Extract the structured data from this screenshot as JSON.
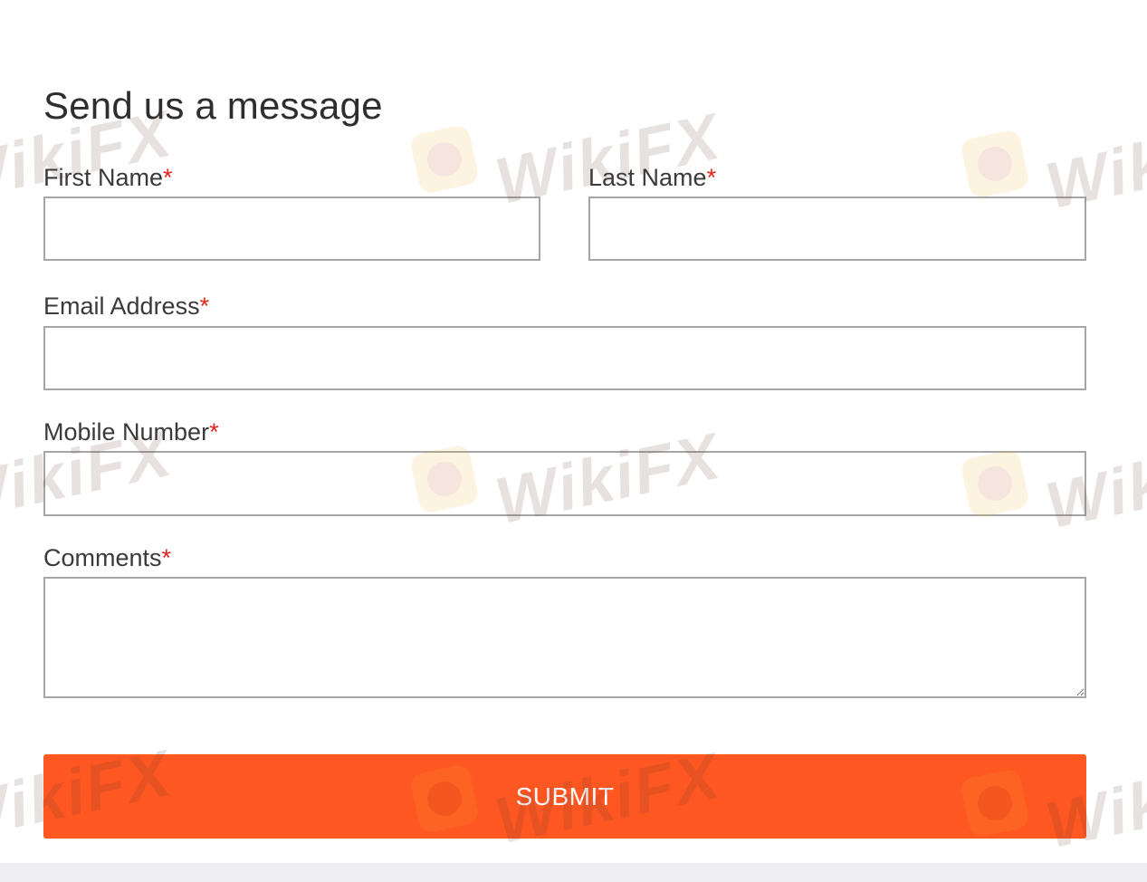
{
  "form": {
    "title": "Send us a message",
    "required_marker": "*",
    "fields": {
      "first_name": {
        "label": "First Name",
        "value": "",
        "placeholder": ""
      },
      "last_name": {
        "label": "Last Name",
        "value": "",
        "placeholder": ""
      },
      "email": {
        "label": "Email Address",
        "value": "",
        "placeholder": ""
      },
      "mobile": {
        "label": "Mobile Number",
        "value": "",
        "placeholder": ""
      },
      "comments": {
        "label": "Comments",
        "value": "",
        "placeholder": ""
      }
    },
    "submit_label": "SUBMIT"
  },
  "watermark": {
    "text": "WikiFX",
    "icon": "wikifx-logo-icon"
  },
  "colors": {
    "accent": "#ff5722",
    "required": "#e3241b",
    "input_border": "#a6a6a6",
    "footer": "#efeff1"
  }
}
